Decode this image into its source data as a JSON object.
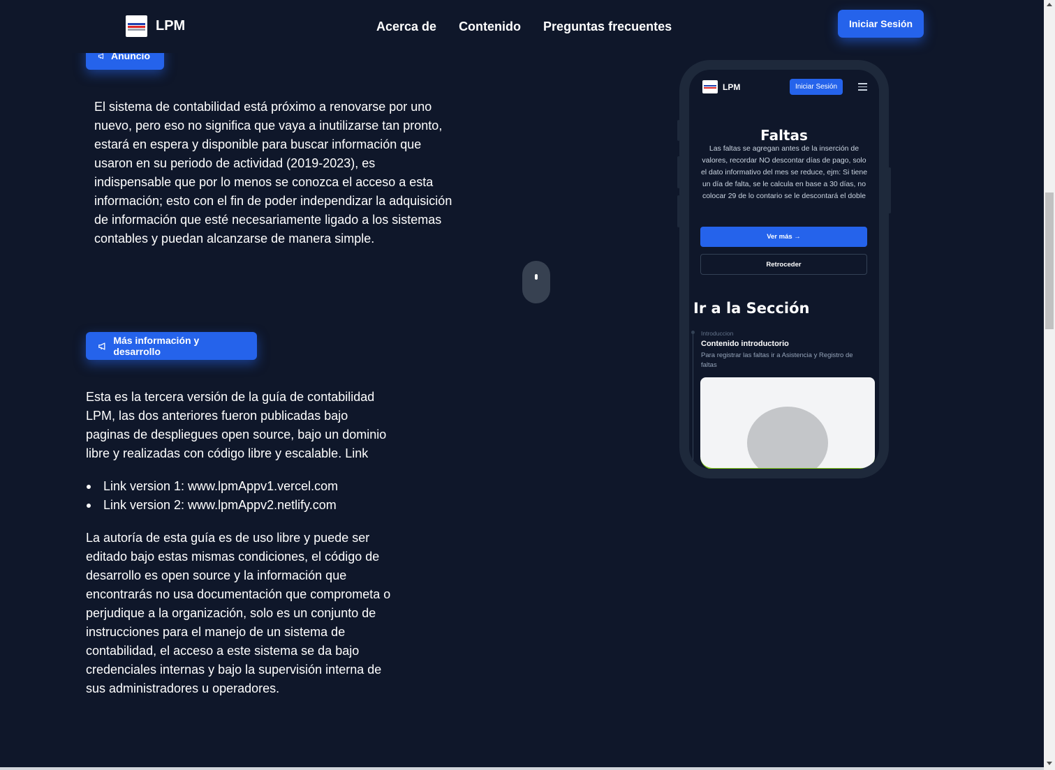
{
  "nav": {
    "brand": "LPM",
    "links": [
      "Acerca de",
      "Contenido",
      "Preguntas frecuentes"
    ],
    "login_label": "Iniciar Sesión"
  },
  "announcement": {
    "badge_label": "Anuncio",
    "text": "El sistema de contabilidad está próximo a renovarse por uno nuevo, pero eso no significa que vaya a inutilizarse tan pronto, estará en espera y disponible para buscar información que usaron en su periodo de actividad (2019-2023), es indispensable que por lo menos se conozca el acceso a esta información; esto con el fin de poder independizar la adquisición de información que esté necesariamente ligado a los sistemas contables y puedan alcanzarse de manera simple."
  },
  "more_info": {
    "badge_label": "Más información y desarrollo",
    "intro": "Esta es la tercera versión de la guía de contabilidad LPM, las dos anteriores fueron publicadas bajo paginas de despliegues open source, bajo un dominio libre y realizadas con código libre y escalable. Link",
    "links": [
      "Link version 1: www.lpmAppv1.vercel.com",
      "Link version 2: www.lpmAppv2.netlify.com"
    ],
    "closing": "La autoría de esta guía es de uso libre y puede ser editado bajo estas mismas condiciones, el código de desarrollo es open source y la información que encontrarás no usa documentación que comprometa o perjudique a la organización, solo es un conjunto de instrucciones para el manejo de un sistema de contabilidad, el acceso a este sistema se da bajo credenciales internas y bajo la supervisión interna de sus administradores u operadores."
  },
  "phone": {
    "brand": "LPM",
    "login_label": "Iniciar Sesión",
    "title": "Faltas",
    "description": "Las faltas se agregan antes de la inserción de valores, recordar NO descontar días de pago, solo el dato informativo del mes se reduce, ejm: Si tiene un día de falta, se le calcula en base a 30 días, no colocar 29 de lo contario se le descontará el doble",
    "primary_button": "Ver más →",
    "secondary_button": "Retroceder",
    "section_heading": "Ir a la Sección",
    "timeline_label": "Introduccion",
    "item_title": "Contenido introductorio",
    "item_text": "Para registrar las faltas ir a Asistencia y Registro de faltas"
  },
  "icons": {
    "announcement": "megaphone-icon",
    "scroll": "mouse-scroll-icon",
    "menu": "hamburger-menu-icon"
  },
  "colors": {
    "background": "#0f172a",
    "accent": "#2563eb",
    "phone_frame": "#1e293b"
  }
}
